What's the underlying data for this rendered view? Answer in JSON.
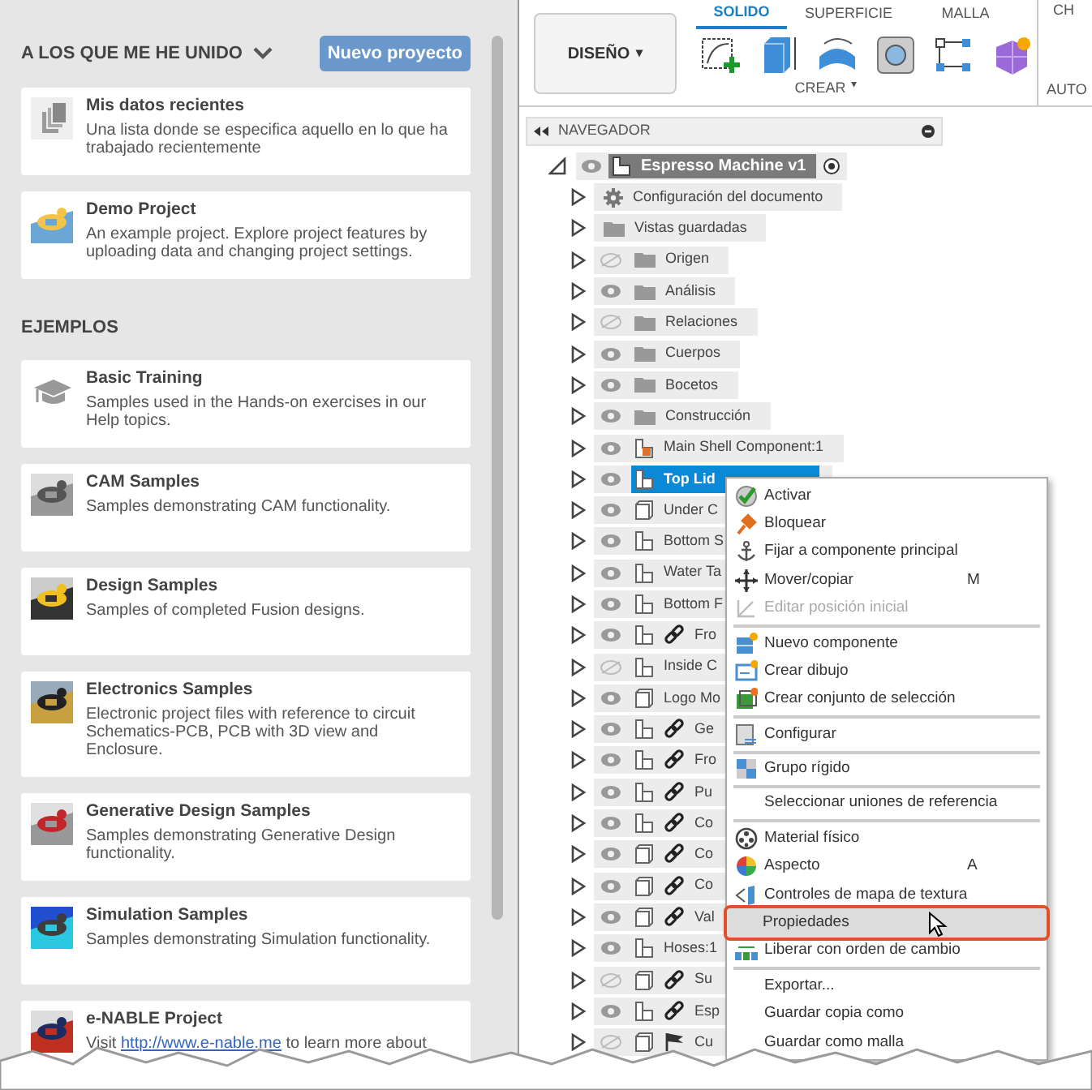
{
  "projects_panel": {
    "section_title": "A LOS QUE ME HE UNIDO",
    "new_project_button": "Nuevo proyecto",
    "joined": [
      {
        "title": "Mis datos recientes",
        "description": "Una lista donde se especifica aquello en lo que ha trabajado recientemente",
        "kind": "documents"
      },
      {
        "title": "Demo Project",
        "description": "An example project. Explore project features by uploading data and changing project settings.",
        "kind": "picture"
      }
    ],
    "examples_title": "EJEMPLOS",
    "examples": [
      {
        "title": "Basic Training",
        "description": "Samples used in the Hands-on exercises in our Help topics.",
        "kind": "cap"
      },
      {
        "title": "CAM Samples",
        "description": "Samples demonstrating CAM functionality.",
        "kind": "picture"
      },
      {
        "title": "Design Samples",
        "description": "Samples of completed Fusion designs.",
        "kind": "picture"
      },
      {
        "title": "Electronics Samples",
        "description": "Electronic project files with reference to circuit Schematics-PCB, PCB with 3D view and Enclosure.",
        "kind": "picture"
      },
      {
        "title": "Generative Design Samples",
        "description": "Samples demonstrating Generative Design functionality.",
        "kind": "picture"
      },
      {
        "title": "Simulation Samples",
        "description": "Samples demonstrating Simulation functionality.",
        "kind": "picture"
      },
      {
        "title": "e-NABLE Project",
        "description_before": "Visit ",
        "link": "http://www.e-nable.me",
        "description_after": " to learn more about",
        "kind": "picture"
      }
    ]
  },
  "toolbar": {
    "workspace": "DISEÑO",
    "workspace_caret": "▾",
    "tabs": [
      {
        "label": "SOLIDO",
        "selected": true
      },
      {
        "label": "SUPERFICIE",
        "selected": false
      },
      {
        "label": "MALLA",
        "selected": false
      },
      {
        "label": "CH",
        "selected": false
      }
    ],
    "group_label": "CREAR",
    "group_caret": "▾",
    "next_group_label": "AUTO"
  },
  "navigator": {
    "title": "NAVEGADOR",
    "root": {
      "label": "Espresso Machine v1",
      "expanded": true,
      "visible": true,
      "children": [
        {
          "label": "Configuración del documento",
          "kind": "gear",
          "expanded": false,
          "selected": false,
          "linked": false,
          "flagged": false
        },
        {
          "label": "Vistas guardadas",
          "kind": "folder",
          "expanded": false,
          "selected": false,
          "linked": false,
          "flagged": false
        },
        {
          "label": "Origen",
          "kind": "folder",
          "visible": false,
          "expanded": false,
          "selected": false,
          "linked": false,
          "flagged": false
        },
        {
          "label": "Análisis",
          "kind": "folder",
          "visible": true,
          "expanded": false,
          "selected": false,
          "linked": false,
          "flagged": false
        },
        {
          "label": "Relaciones",
          "kind": "folder",
          "visible": false,
          "expanded": false,
          "selected": false,
          "linked": false,
          "flagged": false
        },
        {
          "label": "Cuerpos",
          "kind": "folder",
          "visible": true,
          "expanded": false,
          "selected": false,
          "linked": false,
          "flagged": false
        },
        {
          "label": "Bocetos",
          "kind": "folder",
          "visible": true,
          "expanded": false,
          "selected": false,
          "linked": false,
          "flagged": false
        },
        {
          "label": "Construcción",
          "kind": "folder",
          "visible": true,
          "expanded": false,
          "selected": false,
          "linked": false,
          "flagged": false
        },
        {
          "label": "Main Shell Component:1",
          "kind": "active_component",
          "visible": true,
          "expanded": false,
          "selected": false,
          "linked": false,
          "flagged": false
        },
        {
          "label": "Top Lid",
          "kind": "component",
          "visible": true,
          "expanded": false,
          "selected": true,
          "linked": false,
          "flagged": false
        },
        {
          "label": "Under C",
          "kind": "body",
          "visible": true,
          "expanded": false,
          "selected": false,
          "linked": false,
          "flagged": false
        },
        {
          "label": "Bottom S",
          "kind": "component",
          "visible": true,
          "expanded": false,
          "selected": false,
          "linked": false,
          "flagged": false
        },
        {
          "label": "Water Ta",
          "kind": "component",
          "visible": true,
          "expanded": false,
          "selected": false,
          "linked": false,
          "flagged": false
        },
        {
          "label": "Bottom F",
          "kind": "component",
          "visible": true,
          "expanded": false,
          "selected": false,
          "linked": false,
          "flagged": false
        },
        {
          "label": "Fro",
          "kind": "component",
          "visible": true,
          "expanded": false,
          "selected": false,
          "linked": true,
          "flagged": false
        },
        {
          "label": "Inside C",
          "kind": "component",
          "visible": false,
          "expanded": false,
          "selected": false,
          "linked": false,
          "flagged": false
        },
        {
          "label": "Logo Mo",
          "kind": "body",
          "visible": true,
          "expanded": false,
          "selected": false,
          "linked": false,
          "flagged": false
        },
        {
          "label": "Ge",
          "kind": "component",
          "visible": true,
          "expanded": false,
          "selected": false,
          "linked": true,
          "flagged": false
        },
        {
          "label": "Fro",
          "kind": "component",
          "visible": true,
          "expanded": false,
          "selected": false,
          "linked": true,
          "flagged": false
        },
        {
          "label": "Pu",
          "kind": "component",
          "visible": true,
          "expanded": false,
          "selected": false,
          "linked": true,
          "flagged": false
        },
        {
          "label": "Co",
          "kind": "component",
          "visible": true,
          "expanded": false,
          "selected": false,
          "linked": true,
          "flagged": false
        },
        {
          "label": "Co",
          "kind": "body",
          "visible": true,
          "expanded": false,
          "selected": false,
          "linked": true,
          "flagged": false
        },
        {
          "label": "Co",
          "kind": "body",
          "visible": true,
          "expanded": false,
          "selected": false,
          "linked": true,
          "flagged": false
        },
        {
          "label": "Val",
          "kind": "body",
          "visible": true,
          "expanded": false,
          "selected": false,
          "linked": true,
          "flagged": false
        },
        {
          "label": "Hoses:1",
          "kind": "component",
          "visible": true,
          "expanded": false,
          "selected": false,
          "linked": false,
          "flagged": false
        },
        {
          "label": "Su",
          "kind": "body",
          "visible": false,
          "expanded": false,
          "selected": false,
          "linked": true,
          "flagged": false
        },
        {
          "label": "Esp",
          "kind": "component",
          "visible": true,
          "expanded": false,
          "selected": false,
          "linked": true,
          "flagged": false
        },
        {
          "label": "Cu",
          "kind": "body",
          "visible": false,
          "expanded": false,
          "selected": false,
          "linked": false,
          "flagged": true
        }
      ]
    }
  },
  "context_menu": [
    {
      "label": "Activar",
      "kind": "check",
      "disabled": false,
      "selected": false
    },
    {
      "label": "Bloquear",
      "kind": "pin",
      "disabled": false,
      "selected": false
    },
    {
      "label": "Fijar a componente principal",
      "kind": "anchor",
      "disabled": false,
      "selected": false
    },
    {
      "label": "Mover/copiar",
      "kind": "move",
      "shortcut": "M",
      "disabled": false,
      "selected": false
    },
    {
      "label": "Editar posición inicial",
      "kind": "axes",
      "disabled": true,
      "selected": false
    },
    {
      "label": "Nuevo componente",
      "kind": "new_component",
      "separator_before": true,
      "disabled": false,
      "selected": false
    },
    {
      "label": "Crear dibujo",
      "kind": "drawing",
      "disabled": false,
      "selected": false
    },
    {
      "label": "Crear conjunto de selección",
      "kind": "selection_set",
      "disabled": false,
      "selected": false
    },
    {
      "label": "Configurar",
      "kind": "configure",
      "separator_before": true,
      "disabled": false,
      "selected": false
    },
    {
      "label": "Grupo rígido",
      "kind": "rigid",
      "separator_before": true,
      "disabled": false,
      "selected": false
    },
    {
      "label": "Seleccionar uniones de referencia",
      "kind": "text",
      "separator_before": true,
      "disabled": false,
      "selected": false
    },
    {
      "label": "Material físico",
      "kind": "material",
      "separator_before": true,
      "disabled": false,
      "selected": false
    },
    {
      "label": "Aspecto",
      "kind": "appearance",
      "shortcut": "A",
      "disabled": false,
      "selected": false
    },
    {
      "label": "Controles de mapa de textura",
      "kind": "texture",
      "disabled": false,
      "selected": false
    },
    {
      "label": "Propiedades",
      "kind": "text",
      "disabled": false,
      "selected": true
    },
    {
      "label": "Liberar con orden de cambio",
      "kind": "release",
      "disabled": false,
      "selected": false
    },
    {
      "label": "Exportar...",
      "kind": "text",
      "separator_before": true,
      "disabled": false,
      "selected": false
    },
    {
      "label": "Guardar copia como",
      "kind": "text",
      "disabled": false,
      "selected": false
    },
    {
      "label": "Guardar como malla",
      "kind": "text",
      "disabled": false,
      "selected": false
    }
  ]
}
